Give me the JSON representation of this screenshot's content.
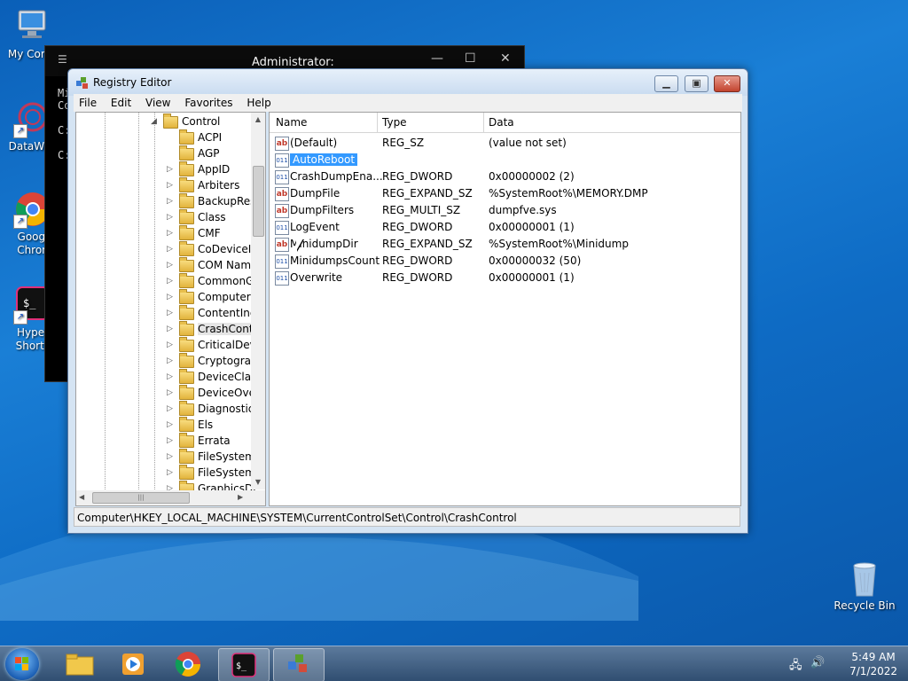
{
  "desktop": {
    "icons": [
      {
        "label": "My Comp",
        "icon": "computer-icon"
      },
      {
        "label": "DataWag",
        "icon": "app-icon"
      },
      {
        "label": "Googl",
        "label2": "Chron",
        "icon": "chrome-icon"
      },
      {
        "label": "Hyper",
        "label2": "Shortc",
        "icon": "terminal-icon"
      },
      {
        "label": "Recycle Bin",
        "icon": "recycle-bin-icon"
      }
    ]
  },
  "console": {
    "title": "Administrator:",
    "lines": [
      "Mi",
      "Co",
      "C:",
      "C:"
    ]
  },
  "regedit": {
    "title": "Registry Editor",
    "menu": [
      "File",
      "Edit",
      "View",
      "Favorites",
      "Help"
    ],
    "tree_root": "Control",
    "tree": [
      "ACPI",
      "AGP",
      "AppID",
      "Arbiters",
      "BackupRes",
      "Class",
      "CMF",
      "CoDeviceIr",
      "COM Nam",
      "CommonG",
      "ComputerI",
      "ContentInc",
      "CrashCont",
      "CriticalDev",
      "Cryptograp",
      "DeviceClas",
      "DeviceOve",
      "Diagnostic",
      "Els",
      "Errata",
      "FileSystem",
      "FileSystem",
      "GraphicsDr"
    ],
    "columns": [
      "Name",
      "Type",
      "Data"
    ],
    "values": [
      {
        "name": "(Default)",
        "type": "REG_SZ",
        "data": "(value not set)",
        "kind": "sz"
      },
      {
        "name": "AutoReboot",
        "type": "",
        "data": "",
        "kind": "bin",
        "selected": true
      },
      {
        "name": "CrashDumpEna...",
        "type": "REG_DWORD",
        "data": "0x00000002 (2)",
        "kind": "bin"
      },
      {
        "name": "DumpFile",
        "type": "REG_EXPAND_SZ",
        "data": "%SystemRoot%\\MEMORY.DMP",
        "kind": "sz"
      },
      {
        "name": "DumpFilters",
        "type": "REG_MULTI_SZ",
        "data": "dumpfve.sys",
        "kind": "sz"
      },
      {
        "name": "LogEvent",
        "type": "REG_DWORD",
        "data": "0x00000001 (1)",
        "kind": "bin"
      },
      {
        "name": "MinidumpDir",
        "type": "REG_EXPAND_SZ",
        "data": "%SystemRoot%\\Minidump",
        "kind": "sz"
      },
      {
        "name": "MinidumpsCount",
        "type": "REG_DWORD",
        "data": "0x00000032 (50)",
        "kind": "bin"
      },
      {
        "name": "Overwrite",
        "type": "REG_DWORD",
        "data": "0x00000001 (1)",
        "kind": "bin"
      }
    ],
    "status": "Computer\\HKEY_LOCAL_MACHINE\\SYSTEM\\CurrentControlSet\\Control\\CrashControl"
  },
  "taskbar": {
    "time": "5:49 AM",
    "date": "7/1/2022"
  }
}
